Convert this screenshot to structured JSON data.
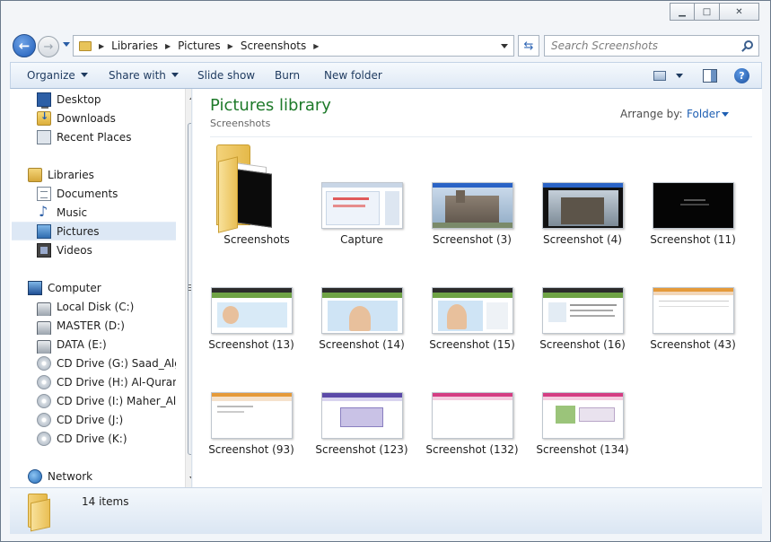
{
  "window": {
    "controls": {
      "minimize": "▁",
      "maximize": "□",
      "close": "✕"
    }
  },
  "nav": {
    "breadcrumb": [
      "Libraries",
      "Pictures",
      "Screenshots"
    ],
    "search_placeholder": "Search Screenshots"
  },
  "toolbar": {
    "organize": "Organize",
    "share_with": "Share with",
    "slide_show": "Slide show",
    "burn": "Burn",
    "new_folder": "New folder"
  },
  "sidebar": {
    "items": [
      {
        "label": "Desktop",
        "icon": "desktop-icon"
      },
      {
        "label": "Downloads",
        "icon": "downloads-folder-icon"
      },
      {
        "label": "Recent Places",
        "icon": "recent-places-icon"
      },
      {
        "label": "Libraries",
        "icon": "libraries-icon"
      },
      {
        "label": "Documents",
        "icon": "documents-icon"
      },
      {
        "label": "Music",
        "icon": "music-icon"
      },
      {
        "label": "Pictures",
        "icon": "pictures-icon",
        "selected": true
      },
      {
        "label": "Videos",
        "icon": "videos-icon"
      },
      {
        "label": "Computer",
        "icon": "computer-icon"
      },
      {
        "label": "Local Disk (C:)",
        "icon": "disk-icon"
      },
      {
        "label": "MASTER (D:)",
        "icon": "disk-icon"
      },
      {
        "label": "DATA (E:)",
        "icon": "disk-icon"
      },
      {
        "label": "CD Drive (G:) Saad_Algha",
        "icon": "cd-drive-icon"
      },
      {
        "label": "CD Drive (H:) Al-Quran M",
        "icon": "cd-drive-icon"
      },
      {
        "label": "CD Drive (I:) Maher_Al-M",
        "icon": "cd-drive-icon"
      },
      {
        "label": "CD Drive (J:)",
        "icon": "cd-drive-icon"
      },
      {
        "label": "CD Drive (K:)",
        "icon": "cd-drive-icon"
      },
      {
        "label": "Network",
        "icon": "network-icon"
      }
    ]
  },
  "content": {
    "title": "Pictures library",
    "subtitle": "Screenshots",
    "arrange_label": "Arrange by:",
    "arrange_value": "Folder",
    "files": [
      "Screenshots",
      "Capture",
      "Screenshot (3)",
      "Screenshot (4)",
      "Screenshot (11)",
      "Screenshot (13)",
      "Screenshot (14)",
      "Screenshot (15)",
      "Screenshot (16)",
      "Screenshot (43)",
      "Screenshot (93)",
      "Screenshot (123)",
      "Screenshot (132)",
      "Screenshot (134)"
    ]
  },
  "status": {
    "items_count": "14 items"
  }
}
